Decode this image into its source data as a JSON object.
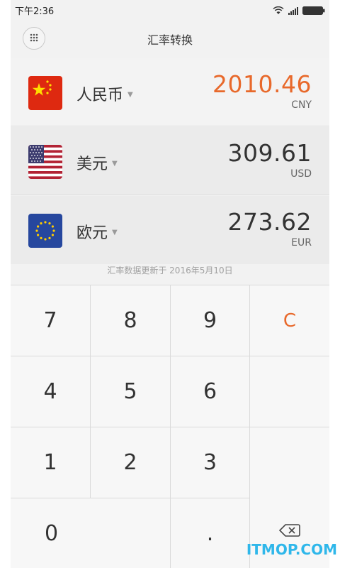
{
  "status_bar": {
    "time": "下午2:36",
    "icons": [
      "wifi-icon",
      "signal-icon",
      "battery-icon"
    ]
  },
  "header": {
    "title": "汇率转换",
    "menu_icon": "grid-dots-icon"
  },
  "currencies": [
    {
      "name": "人民币",
      "amount": "2010.46",
      "code": "CNY",
      "flag": "china-flag",
      "active": true
    },
    {
      "name": "美元",
      "amount": "309.61",
      "code": "USD",
      "flag": "usa-flag",
      "active": false
    },
    {
      "name": "欧元",
      "amount": "273.62",
      "code": "EUR",
      "flag": "eu-flag",
      "active": false
    }
  ],
  "update_note": "汇率数据更新于 2016年5月10日",
  "keypad": {
    "k7": "7",
    "k8": "8",
    "k9": "9",
    "k4": "4",
    "k5": "5",
    "k6": "6",
    "k1": "1",
    "k2": "2",
    "k3": "3",
    "k0": "0",
    "kdot": ".",
    "clear": "C",
    "backspace_icon": "backspace-icon"
  },
  "watermark": "ITMOP.COM",
  "colors": {
    "accent": "#e8692b",
    "background": "#f2f2f2",
    "watermark": "#2fb7ea"
  }
}
